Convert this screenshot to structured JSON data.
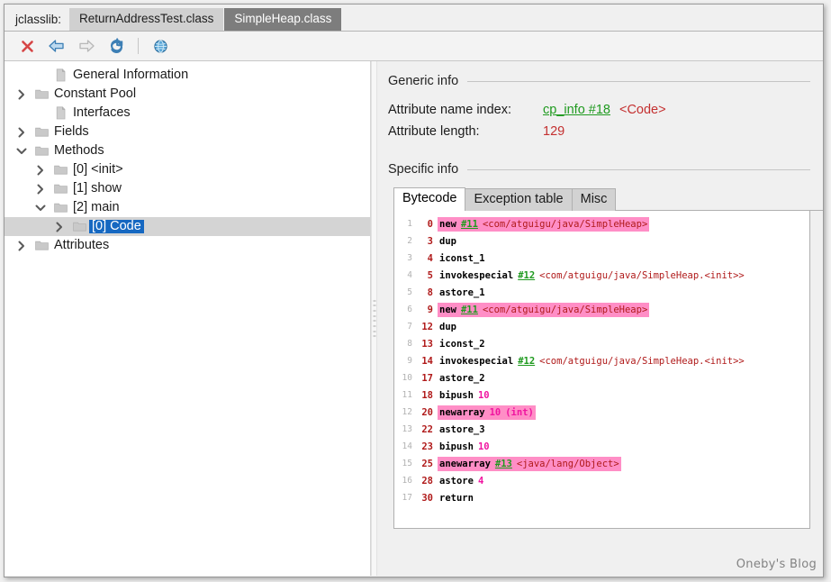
{
  "window": {
    "app_label": "jclasslib:",
    "tabs": [
      {
        "label": "ReturnAddressTest.class",
        "active": false
      },
      {
        "label": "SimpleHeap.class",
        "active": true
      }
    ]
  },
  "toolbar": {
    "buttons": [
      {
        "name": "close-icon",
        "title": "Close"
      },
      {
        "name": "back-arrow-icon",
        "title": "Back"
      },
      {
        "name": "forward-arrow-icon",
        "title": "Forward"
      },
      {
        "name": "reload-icon",
        "title": "Reload"
      },
      {
        "name": "browse-web-icon",
        "title": "Browse"
      }
    ]
  },
  "tree": {
    "items": [
      {
        "label": "General Information",
        "indent": 1,
        "twisty": "none",
        "icon": "file-icon",
        "selected": false
      },
      {
        "label": "Constant Pool",
        "indent": 0,
        "twisty": "collapsed",
        "icon": "folder-icon",
        "selected": false
      },
      {
        "label": "Interfaces",
        "indent": 1,
        "twisty": "none",
        "icon": "file-icon",
        "selected": false
      },
      {
        "label": "Fields",
        "indent": 0,
        "twisty": "collapsed",
        "icon": "folder-icon",
        "selected": false
      },
      {
        "label": "Methods",
        "indent": 0,
        "twisty": "expanded",
        "icon": "folder-icon",
        "selected": false
      },
      {
        "label": "[0] <init>",
        "indent": 1,
        "twisty": "collapsed",
        "icon": "folder-icon",
        "selected": false
      },
      {
        "label": "[1] show",
        "indent": 1,
        "twisty": "collapsed",
        "icon": "folder-icon",
        "selected": false
      },
      {
        "label": "[2] main",
        "indent": 1,
        "twisty": "expanded",
        "icon": "folder-icon",
        "selected": false
      },
      {
        "label": "[0] Code",
        "indent": 2,
        "twisty": "collapsed",
        "icon": "folder-icon",
        "selected": true
      },
      {
        "label": "Attributes",
        "indent": 0,
        "twisty": "collapsed",
        "icon": "folder-icon",
        "selected": false
      }
    ]
  },
  "detail": {
    "generic_info": {
      "title": "Generic info",
      "rows": [
        {
          "key": "Attribute name index:",
          "link": "cp_info #18",
          "extra": "<Code>",
          "value": ""
        },
        {
          "key": "Attribute length:",
          "link": "",
          "extra": "",
          "value": "129"
        }
      ]
    },
    "specific_info": {
      "title": "Specific info",
      "tabs": [
        {
          "label": "Bytecode",
          "active": true
        },
        {
          "label": "Exception table",
          "active": false
        },
        {
          "label": "Misc",
          "active": false
        }
      ]
    },
    "bytecode": [
      {
        "line": "1",
        "offset": "0",
        "op": "new",
        "ref": "#11",
        "comment": "<com/atguigu/java/SimpleHeap>",
        "num": "",
        "type": "",
        "highlight": true
      },
      {
        "line": "2",
        "offset": "3",
        "op": "dup",
        "ref": "",
        "comment": "",
        "num": "",
        "type": "",
        "highlight": false
      },
      {
        "line": "3",
        "offset": "4",
        "op": "iconst_1",
        "ref": "",
        "comment": "",
        "num": "",
        "type": "",
        "highlight": false
      },
      {
        "line": "4",
        "offset": "5",
        "op": "invokespecial",
        "ref": "#12",
        "comment": "<com/atguigu/java/SimpleHeap.<init>>",
        "num": "",
        "type": "",
        "highlight": false
      },
      {
        "line": "5",
        "offset": "8",
        "op": "astore_1",
        "ref": "",
        "comment": "",
        "num": "",
        "type": "",
        "highlight": false
      },
      {
        "line": "6",
        "offset": "9",
        "op": "new",
        "ref": "#11",
        "comment": "<com/atguigu/java/SimpleHeap>",
        "num": "",
        "type": "",
        "highlight": true
      },
      {
        "line": "7",
        "offset": "12",
        "op": "dup",
        "ref": "",
        "comment": "",
        "num": "",
        "type": "",
        "highlight": false
      },
      {
        "line": "8",
        "offset": "13",
        "op": "iconst_2",
        "ref": "",
        "comment": "",
        "num": "",
        "type": "",
        "highlight": false
      },
      {
        "line": "9",
        "offset": "14",
        "op": "invokespecial",
        "ref": "#12",
        "comment": "<com/atguigu/java/SimpleHeap.<init>>",
        "num": "",
        "type": "",
        "highlight": false
      },
      {
        "line": "10",
        "offset": "17",
        "op": "astore_2",
        "ref": "",
        "comment": "",
        "num": "",
        "type": "",
        "highlight": false
      },
      {
        "line": "11",
        "offset": "18",
        "op": "bipush",
        "ref": "",
        "comment": "",
        "num": "10",
        "type": "",
        "highlight": false
      },
      {
        "line": "12",
        "offset": "20",
        "op": "newarray",
        "ref": "",
        "comment": "",
        "num": "10",
        "type": "(int)",
        "highlight": true
      },
      {
        "line": "13",
        "offset": "22",
        "op": "astore_3",
        "ref": "",
        "comment": "",
        "num": "",
        "type": "",
        "highlight": false
      },
      {
        "line": "14",
        "offset": "23",
        "op": "bipush",
        "ref": "",
        "comment": "",
        "num": "10",
        "type": "",
        "highlight": false
      },
      {
        "line": "15",
        "offset": "25",
        "op": "anewarray",
        "ref": "#13",
        "comment": "<java/lang/Object>",
        "num": "",
        "type": "",
        "highlight": true
      },
      {
        "line": "16",
        "offset": "28",
        "op": "astore",
        "ref": "",
        "comment": "",
        "num": "4",
        "type": "",
        "highlight": false
      },
      {
        "line": "17",
        "offset": "30",
        "op": "return",
        "ref": "",
        "comment": "",
        "num": "",
        "type": "",
        "highlight": false
      }
    ]
  },
  "watermark": {
    "text": "Oneby's Blog"
  },
  "colors": {
    "highlight_pink": "#ff8ec6",
    "cp_link_green": "#1f9a1f",
    "comment_red": "#b01a1a",
    "number_magenta": "#f014a0",
    "selection_blue": "#1668c1",
    "active_tab_gray": "#7d7d7d"
  }
}
